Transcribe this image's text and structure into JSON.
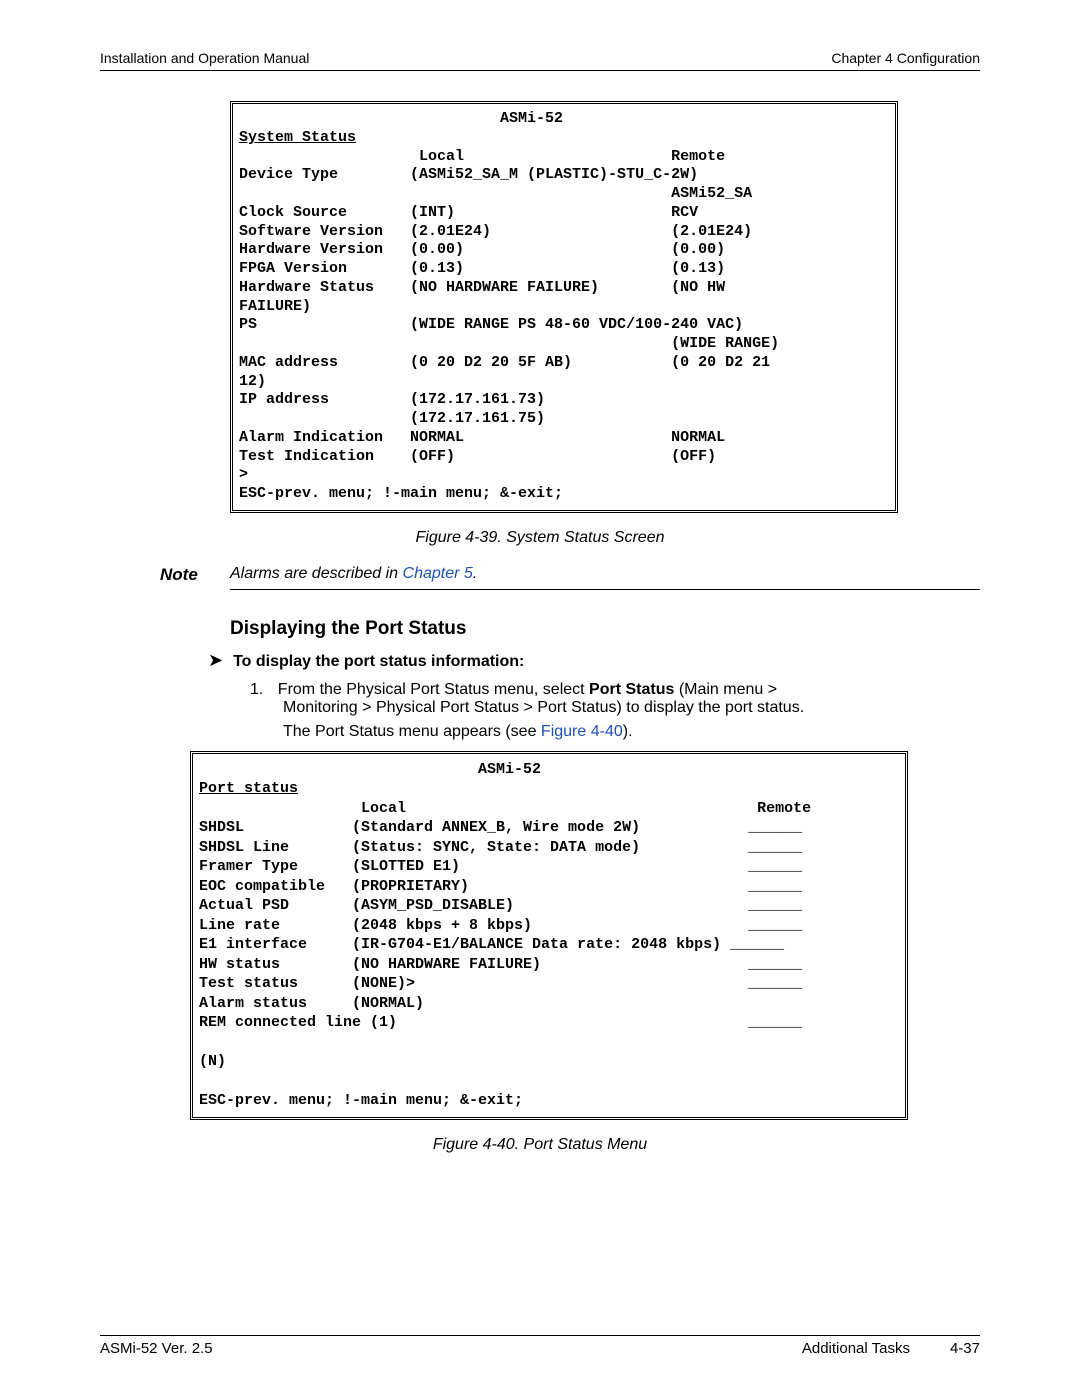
{
  "header": {
    "left": "Installation and Operation Manual",
    "right": "Chapter 4  Configuration"
  },
  "term1": {
    "title_center": "                             ASMi-52",
    "heading": "System Status",
    "cols": "                    Local                       Remote",
    "rows": [
      "Device Type        (ASMi52_SA_M (PLASTIC)-STU_C-2W)",
      "                                                ASMi52_SA",
      "Clock Source       (INT)                        RCV",
      "Software Version   (2.01E24)                    (2.01E24)",
      "Hardware Version   (0.00)                       (0.00)",
      "FPGA Version       (0.13)                       (0.13)",
      "Hardware Status    (NO HARDWARE FAILURE)        (NO HW",
      "FAILURE)",
      "PS                 (WIDE RANGE PS 48-60 VDC/100-240 VAC)",
      "                                                (WIDE RANGE)",
      "MAC address        (0 20 D2 20 5F AB)           (0 20 D2 21",
      "12)",
      "IP address         (172.17.161.73)",
      "                   (172.17.161.75)",
      "Alarm Indication   NORMAL                       NORMAL",
      "Test Indication    (OFF)                        (OFF)",
      ">",
      "ESC-prev. menu; !-main menu; &-exit;"
    ]
  },
  "figcap1": {
    "label": "Figure 4-39.",
    "text": "System Status Screen"
  },
  "note": {
    "label": "Note",
    "text_before": "Alarms are described in ",
    "link": "Chapter 5",
    "text_after": "."
  },
  "h3": "Displaying the Port Status",
  "proc": {
    "arrow": "➤",
    "title": "To display the port status information:"
  },
  "step1": {
    "num": "1.",
    "line1a": "From the Physical Port Status menu, select ",
    "bold": "Port Status",
    "line1b": " (Main menu > ",
    "line2": "Monitoring > Physical Port Status > Port Status) to display the port status.",
    "sub_before": "The Port Status menu appears (see ",
    "sub_link": "Figure 4-40",
    "sub_after": ")."
  },
  "term2": {
    "title_center": "                               ASMi-52",
    "heading": "Port status",
    "cols": "                  Local                                       Remote",
    "rows": [
      "SHDSL            (Standard ANNEX_B, Wire mode 2W)            ______",
      "SHDSL Line       (Status: SYNC, State: DATA mode)            ______",
      "Framer Type      (SLOTTED E1)                                ______",
      "EOC compatible   (PROPRIETARY)                               ______",
      "Actual PSD       (ASYM_PSD_DISABLE)                          ______",
      "Line rate        (2048 kbps + 8 kbps)                        ______",
      "E1 interface     (IR-G704-E1/BALANCE Data rate: 2048 kbps) ______",
      "HW status        (NO HARDWARE FAILURE)                       ______",
      "Test status      (NONE)>                                     ______",
      "Alarm status     (NORMAL)                                    ",
      "REM connected line (1)                                       ______",
      "",
      "(N)",
      "",
      "ESC-prev. menu; !-main menu; &-exit;"
    ]
  },
  "figcap2": {
    "label": "Figure 4-40.",
    "text": "Port Status Menu"
  },
  "footer": {
    "left": "ASMi-52 Ver. 2.5",
    "right1": "Additional Tasks",
    "right2": "4-37"
  }
}
